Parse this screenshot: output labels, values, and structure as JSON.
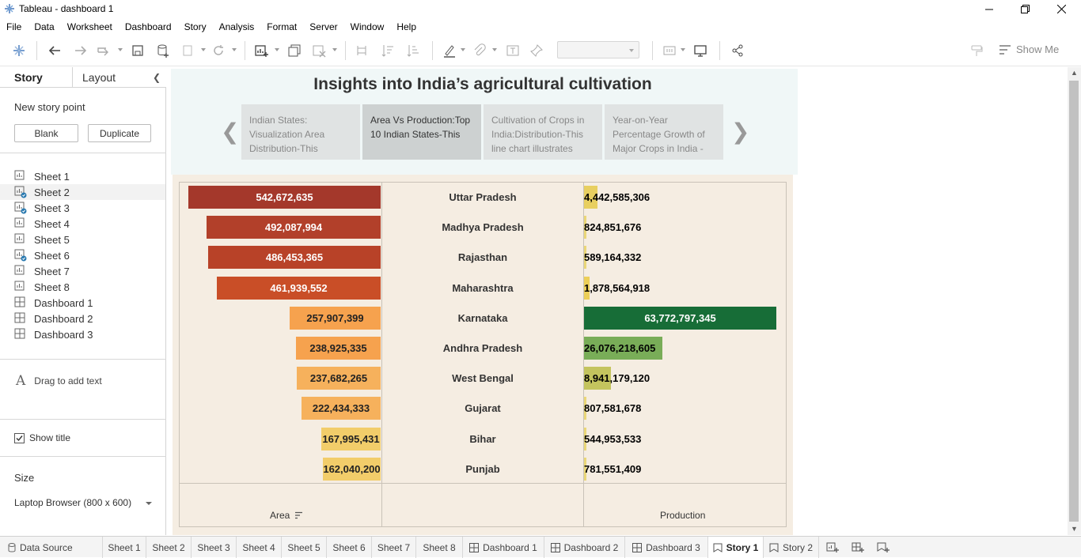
{
  "window": {
    "title": "Tableau - dashboard 1"
  },
  "menu": [
    "File",
    "Data",
    "Worksheet",
    "Dashboard",
    "Story",
    "Analysis",
    "Format",
    "Server",
    "Window",
    "Help"
  ],
  "toolbar": {
    "show_me": "Show Me"
  },
  "left_panel": {
    "tab_story": "Story",
    "tab_layout": "Layout",
    "new_story_point": "New story point",
    "blank_button": "Blank",
    "duplicate_button": "Duplicate",
    "sheets": [
      {
        "label": "Sheet 1",
        "kind": "sheet",
        "used": false
      },
      {
        "label": "Sheet 2",
        "kind": "sheet",
        "used": true
      },
      {
        "label": "Sheet 3",
        "kind": "sheet",
        "used": true
      },
      {
        "label": "Sheet 4",
        "kind": "sheet",
        "used": false
      },
      {
        "label": "Sheet 5",
        "kind": "sheet",
        "used": false
      },
      {
        "label": "Sheet 6",
        "kind": "sheet",
        "used": true
      },
      {
        "label": "Sheet 7",
        "kind": "sheet",
        "used": false
      },
      {
        "label": "Sheet 8",
        "kind": "sheet",
        "used": false
      },
      {
        "label": "Dashboard 1",
        "kind": "dashboard",
        "used": false
      },
      {
        "label": "Dashboard 2",
        "kind": "dashboard",
        "used": false
      },
      {
        "label": "Dashboard 3",
        "kind": "dashboard",
        "used": false
      }
    ],
    "drag_text": "Drag to add text",
    "show_title": "Show title",
    "size_title": "Size",
    "size_value": "Laptop Browser (800 x 600)"
  },
  "story": {
    "title": "Insights into India’s agricultural cultivation",
    "points": [
      "Indian States: Visualization Area Distribution-This",
      "Area Vs Production:Top 10 Indian States-This",
      "Cultivation of Crops in India:Distribution-This line chart illustrates",
      "Year-on-Year Percentage Growth of Major Crops in India -"
    ],
    "active_point": 1
  },
  "chart_data": {
    "type": "bar",
    "categories": [
      "Uttar Pradesh",
      "Madhya Pradesh",
      "Rajasthan",
      "Maharashtra",
      "Karnataka",
      "Andhra Pradesh",
      "West Bengal",
      "Gujarat",
      "Bihar",
      "Punjab"
    ],
    "series": [
      {
        "name": "Area",
        "values": [
          542672635,
          492087994,
          486453365,
          461939552,
          257907399,
          238925335,
          237682265,
          222434333,
          167995431,
          162040200
        ],
        "labels": [
          "542,672,635",
          "492,087,994",
          "486,453,365",
          "461,939,552",
          "257,907,399",
          "238,925,335",
          "237,682,265",
          "222,434,333",
          "167,995,431",
          "162,040,200"
        ],
        "colors": [
          "#a4382b",
          "#b2402a",
          "#b84228",
          "#c94e27",
          "#f6a24e",
          "#f6a24e",
          "#f6b15c",
          "#f6b15c",
          "#f2cd6a",
          "#f2cd6a"
        ],
        "text_colors": [
          "#fff",
          "#fff",
          "#fff",
          "#fff",
          "#222",
          "#222",
          "#222",
          "#222",
          "#222",
          "#222"
        ]
      },
      {
        "name": "Production",
        "values": [
          4442585306,
          824851676,
          589164332,
          1878564918,
          63772797345,
          26076218605,
          8941179120,
          807581678,
          544953533,
          781551409
        ],
        "labels": [
          "4,442,585,306",
          "824,851,676",
          "589,164,332",
          "1,878,564,918",
          "63,772,797,345",
          "26,076,218,605",
          "8,941,179,120",
          "807,581,678",
          "544,953,533",
          "781,551,409"
        ],
        "colors": [
          "#e8cf60",
          "#ead778",
          "#ead778",
          "#eccf58",
          "#176d37",
          "#79ad58",
          "#c4c45e",
          "#ead778",
          "#ead778",
          "#ead778"
        ],
        "text_colors": [
          "#000",
          "#000",
          "#000",
          "#000",
          "#fff",
          "#000",
          "#000",
          "#000",
          "#000",
          "#000"
        ]
      }
    ],
    "xlabels": [
      "Area",
      "Production"
    ]
  },
  "bottom_tabs": [
    {
      "label": "Data Source",
      "kind": "datasource",
      "active": false
    },
    {
      "label": "Sheet 1",
      "kind": "plain",
      "active": false
    },
    {
      "label": "Sheet 2",
      "kind": "plain",
      "active": false
    },
    {
      "label": "Sheet 3",
      "kind": "plain",
      "active": false
    },
    {
      "label": "Sheet 4",
      "kind": "plain",
      "active": false
    },
    {
      "label": "Sheet 5",
      "kind": "plain",
      "active": false
    },
    {
      "label": "Sheet 6",
      "kind": "plain",
      "active": false
    },
    {
      "label": "Sheet 7",
      "kind": "plain",
      "active": false
    },
    {
      "label": "Sheet 8",
      "kind": "plain",
      "active": false
    },
    {
      "label": "Dashboard 1",
      "kind": "dashboard",
      "active": false
    },
    {
      "label": "Dashboard 2",
      "kind": "dashboard",
      "active": false
    },
    {
      "label": "Dashboard 3",
      "kind": "dashboard",
      "active": false
    },
    {
      "label": "Story 1",
      "kind": "story",
      "active": true
    },
    {
      "label": "Story 2",
      "kind": "story",
      "active": false
    }
  ]
}
